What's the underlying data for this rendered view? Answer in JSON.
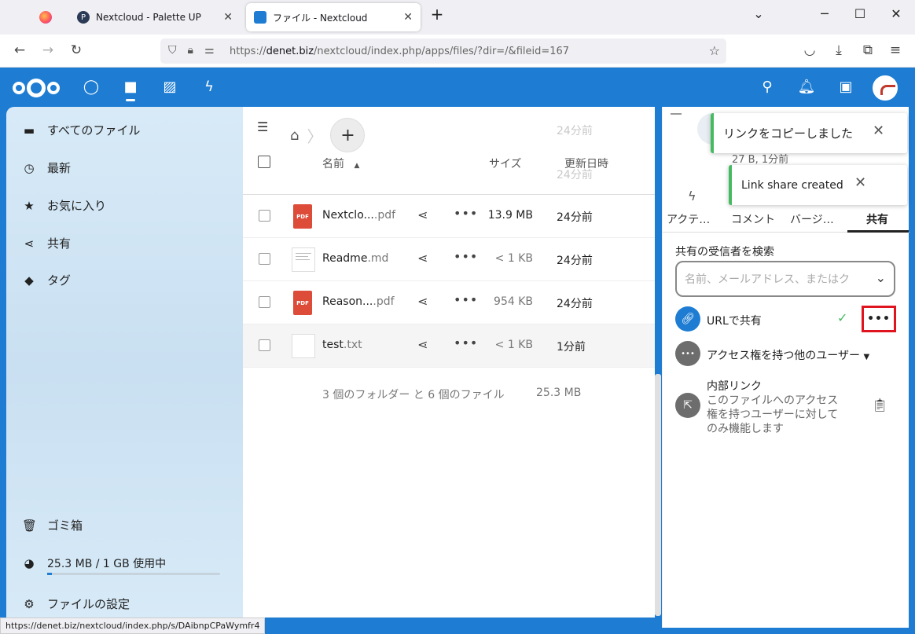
{
  "browser": {
    "tabs": [
      {
        "label": ""
      },
      {
        "label": "Nextcloud - Palette UP"
      },
      {
        "label": "ファイル - Nextcloud"
      }
    ],
    "new_tab": "+",
    "url_prefix": "https://",
    "url_domain": "denet.biz",
    "url_path": "/nextcloud/index.php/apps/files/?dir=/&fileid=167",
    "status_url": "https://denet.biz/nextcloud/index.php/s/DAibnpCPaWymfr4"
  },
  "sidebar": {
    "items": [
      {
        "icon": "folder-icon",
        "label": "すべてのファイル"
      },
      {
        "icon": "clock-icon",
        "label": "最新"
      },
      {
        "icon": "star-icon",
        "label": "お気に入り"
      },
      {
        "icon": "share-icon",
        "label": "共有"
      },
      {
        "icon": "tag-icon",
        "label": "タグ"
      }
    ],
    "trash": "ゴミ箱",
    "quota": "25.3 MB / 1 GB 使用中",
    "quota_fraction": 0.025,
    "settings": "ファイルの設定"
  },
  "files": {
    "columns": {
      "name": "名前",
      "size": "サイズ",
      "modified": "更新日時"
    },
    "ghost_date_1": "24分前",
    "ghost_date_2": "24分前",
    "rows": [
      {
        "name": "Nextclo...",
        "ext": ".pdf",
        "size": "13.9 MB",
        "date": "24分前",
        "type": "pdf"
      },
      {
        "name": "Readme",
        "ext": ".md",
        "size": "< 1 KB",
        "date": "24分前",
        "type": "doc"
      },
      {
        "name": "Reason...",
        "ext": ".pdf",
        "size": "954 KB",
        "date": "24分前",
        "type": "pdf"
      },
      {
        "name": "test",
        "ext": ".txt",
        "size": "< 1 KB",
        "date": "1分前",
        "type": "blank"
      }
    ],
    "summary": "3 個のフォルダー と 6 個のファイル",
    "summary_size": "25.3 MB"
  },
  "details": {
    "toast_copied": "リンクをコピーしました",
    "toast_created": "Link share created",
    "file_meta": "27 B, 1分前",
    "tabs": [
      "アクテ…",
      "コメント",
      "バージ…",
      "共有"
    ],
    "search_label": "共有の受信者を検索",
    "search_placeholder": "名前、メールアドレス、またはク",
    "url_share": "URLで共有",
    "others_access": "アクセス権を持つ他のユーザー",
    "internal_link_title": "内部リンク",
    "internal_link_desc_1": "このファイルへのアクセス",
    "internal_link_desc_2": "権を持つユーザーに対して",
    "internal_link_desc_3": "のみ機能します"
  },
  "colors": {
    "accent": "#1e7dd3",
    "success": "#46ba61",
    "highlight": "#e0141e"
  }
}
